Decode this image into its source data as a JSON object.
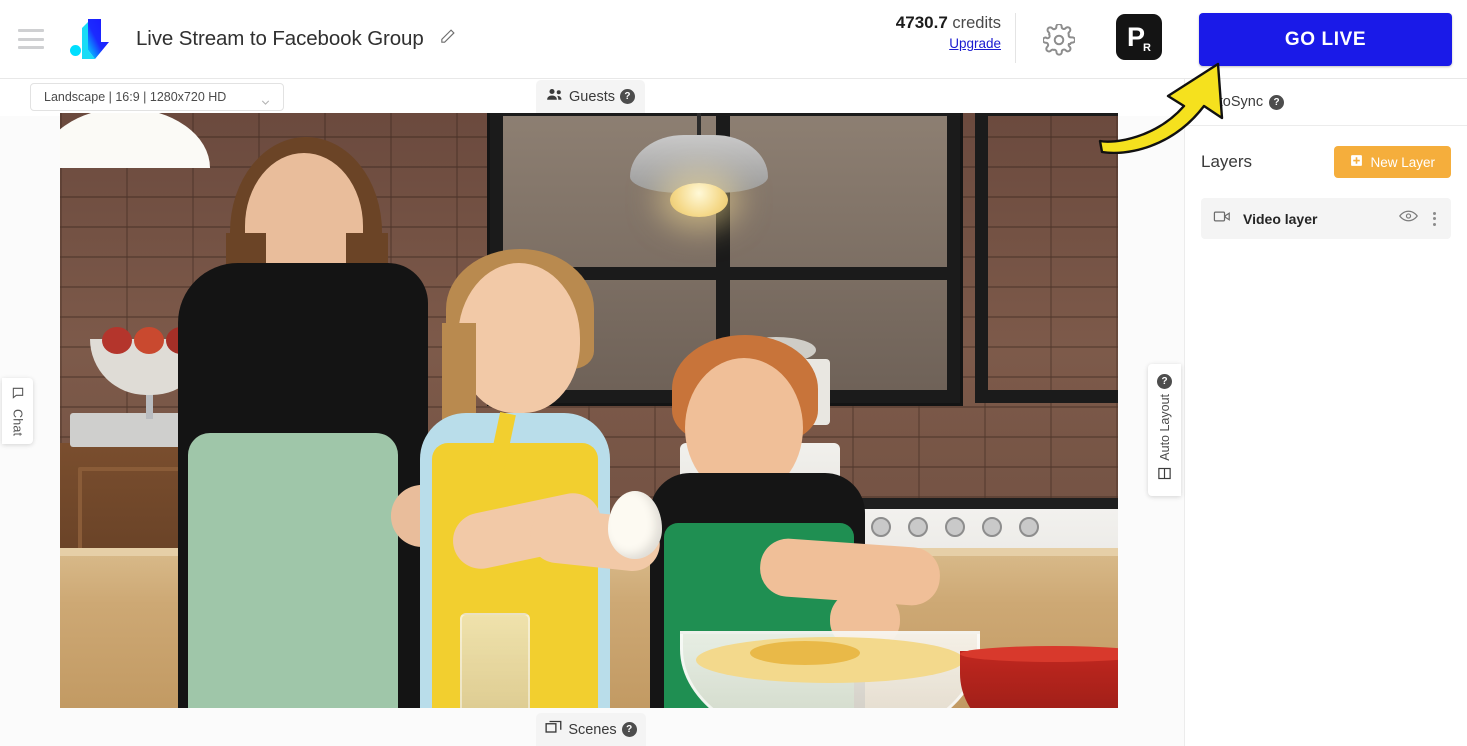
{
  "topbar": {
    "menu_icon": "hamburger-icon",
    "logo_icon": "brand-logo-icon",
    "doc_title": "Live Stream to Facebook Group",
    "edit_icon": "pencil-icon",
    "credits_value": "4730.7",
    "credits_label": "credits",
    "upgrade_label": "Upgrade",
    "settings_icon": "gear-icon",
    "avatar_initial": "P",
    "avatar_sub": "R",
    "go_live_label": "GO LIVE",
    "go_live_color": "#1a1ae8"
  },
  "toolbar": {
    "layout_select_value": "Landscape | 16:9 | 1280x720 HD",
    "chevron_icon": "chevron-down-icon",
    "guests_label": "Guests",
    "guests_icon": "users-icon",
    "guests_help_icon": "help-circle-icon"
  },
  "stage": {
    "scenes_label": "Scenes",
    "scenes_icon": "scenes-icon",
    "scenes_help_icon": "help-circle-icon",
    "chat_label": "Chat",
    "chat_icon": "chat-bubble-icon",
    "auto_layout_label": "Auto Layout",
    "auto_layout_icon": "layout-grid-icon",
    "auto_layout_help_icon": "help-circle-icon"
  },
  "right_panel": {
    "autosync_label": "AutoSync",
    "autosync_help_icon": "help-circle-icon",
    "layers_title": "Layers",
    "new_layer_label": "New Layer",
    "new_layer_icon": "plus-square-icon",
    "new_layer_color": "#f5ae3c",
    "layers": [
      {
        "name": "Video layer",
        "type_icon": "video-camera-icon",
        "visibility_icon": "eye-icon",
        "menu_icon": "kebab-menu-icon"
      }
    ]
  },
  "annotation": {
    "arrow_icon": "curved-arrow-annotation",
    "arrow_color": "#f5e11e",
    "points_to": "GO LIVE"
  }
}
